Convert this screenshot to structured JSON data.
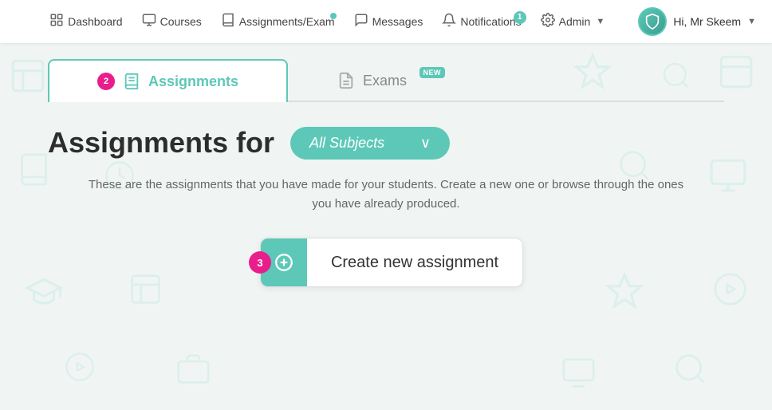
{
  "navbar": {
    "items": [
      {
        "id": "dashboard",
        "label": "Dashboard",
        "icon": "🏠",
        "badge": null
      },
      {
        "id": "courses",
        "label": "Courses",
        "icon": "🖥",
        "badge": null
      },
      {
        "id": "assignments",
        "label": "Assignments/Exam",
        "icon": "📋",
        "badge": "dot"
      },
      {
        "id": "messages",
        "label": "Messages",
        "icon": "💬",
        "badge": null
      },
      {
        "id": "notifications",
        "label": "Notifications",
        "icon": "🔔",
        "badge": "1"
      },
      {
        "id": "admin",
        "label": "Admin",
        "icon": "⚙️",
        "badge": null,
        "dropdown": true
      }
    ],
    "user": {
      "greeting": "Hi, Mr Skeem",
      "avatar_icon": "🛡"
    }
  },
  "tabs": [
    {
      "id": "assignments",
      "label": "Assignments",
      "icon": "📝",
      "active": true,
      "step_num": "2",
      "new_badge": null
    },
    {
      "id": "exams",
      "label": "Exams",
      "icon": "📄",
      "active": false,
      "step_num": null,
      "new_badge": "NEW"
    }
  ],
  "page": {
    "heading": "Assignments for",
    "subject_dropdown": "All Subjects",
    "description": "These are the assignments that you have made for your students. Create a new one or browse through the ones you have already produced.",
    "create_button_label": "Create new assignment",
    "create_button_step": "3"
  },
  "colors": {
    "teal": "#5dc8b8",
    "pink": "#e91e8c",
    "text_dark": "#2d2d2d",
    "text_muted": "#666666",
    "bg": "#f0f5f4"
  }
}
